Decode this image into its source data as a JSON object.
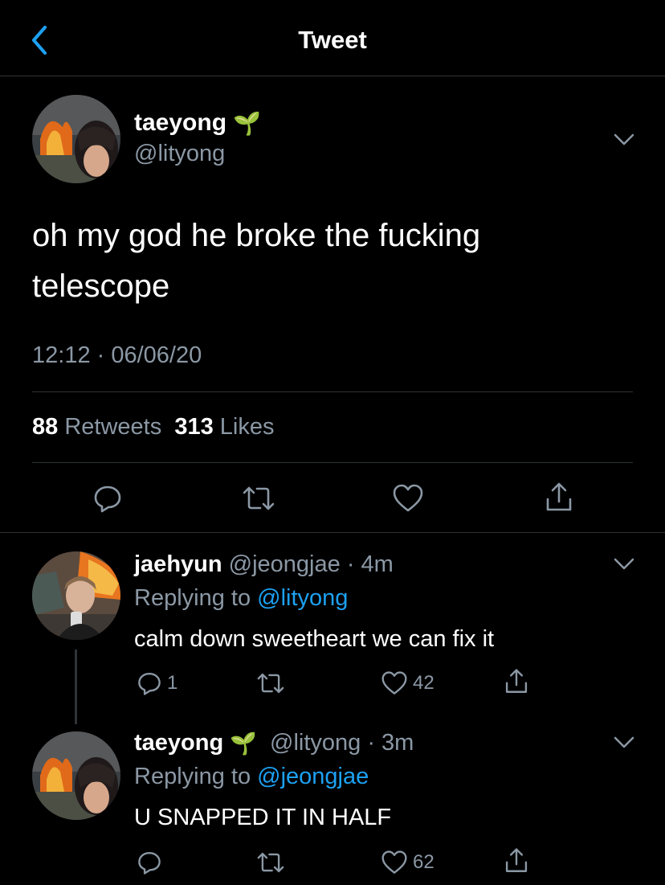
{
  "nav": {
    "title": "Tweet",
    "back_icon": "chevron-left-icon"
  },
  "main_tweet": {
    "display_name": "taeyong",
    "emoji": "🌱",
    "handle": "@lityong",
    "text": "oh my god he broke the fucking telescope",
    "timestamp": "12:12 · 06/06/20",
    "retweets_count": "88",
    "retweets_label": "Retweets",
    "likes_count": "313",
    "likes_label": "Likes"
  },
  "replies": [
    {
      "display_name": "jaehyun",
      "handle": "@jeongjae",
      "time": "· 4m",
      "replying_prefix": "Replying to",
      "replying_to": "@lityong",
      "text": "calm down sweetheart we can fix it",
      "reply_count": "1",
      "retweet_count": "",
      "like_count": "42"
    },
    {
      "display_name": "taeyong",
      "emoji": "🌱",
      "handle": "@lityong",
      "time": "· 3m",
      "replying_prefix": "Replying to",
      "replying_to": "@jeongjae",
      "text": "U SNAPPED IT IN HALF",
      "reply_count": "",
      "retweet_count": "",
      "like_count": "62"
    }
  ],
  "colors": {
    "background": "#000000",
    "text": "#ffffff",
    "muted": "#8b98a5",
    "link": "#1da1f2",
    "divider": "#2f3336"
  }
}
